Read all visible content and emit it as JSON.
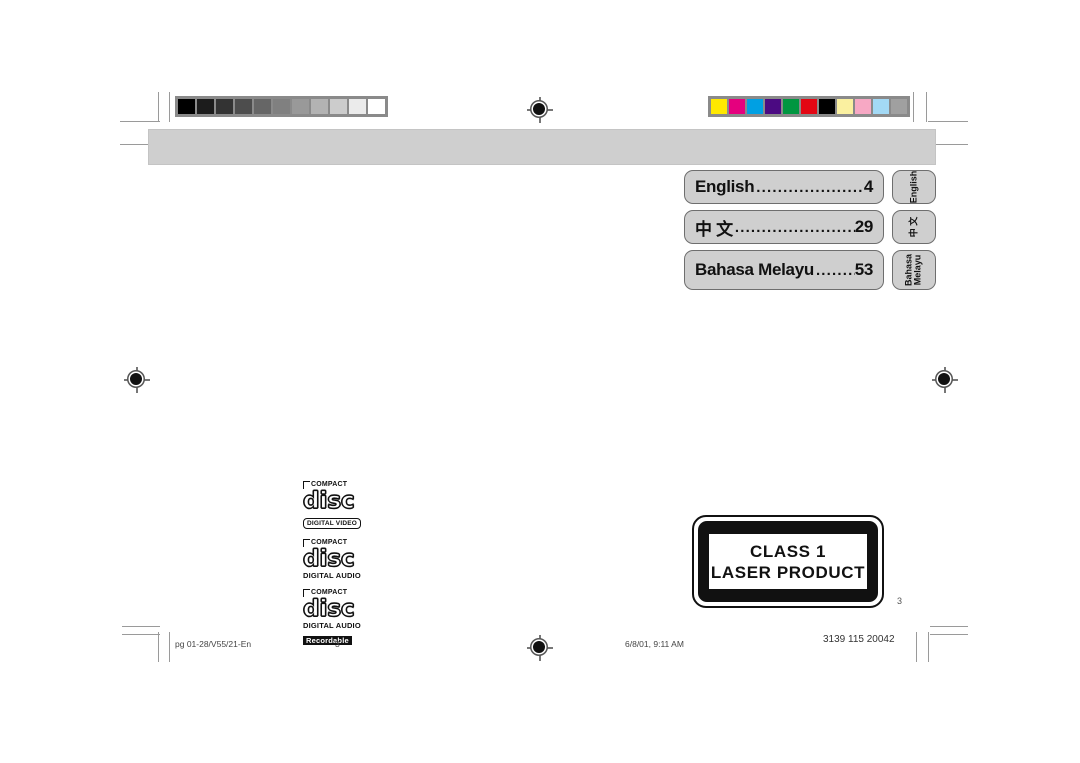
{
  "document": {
    "type": "printed-manual-page",
    "page_number": "3"
  },
  "banner": {
    "label": ""
  },
  "language_index": {
    "rows": [
      {
        "name": "English",
        "leader": "......................................",
        "page": "4",
        "tab": "English"
      },
      {
        "name": "中 文",
        "leader": "........................................",
        "page": "29",
        "tab": "中 文"
      },
      {
        "name": "Bahasa Melayu",
        "leader": "....................",
        "page": "53",
        "tab": "Bahasa\nMelayu"
      }
    ]
  },
  "logos": {
    "cd_items": [
      {
        "compact": "COMPACT",
        "word": "disc",
        "sub": "DIGITAL VIDEO",
        "sub_style": "boxed",
        "sub2": ""
      },
      {
        "compact": "COMPACT",
        "word": "disc",
        "sub": "DIGITAL AUDIO",
        "sub_style": "plain",
        "sub2": ""
      },
      {
        "compact": "COMPACT",
        "word": "disc",
        "sub": "DIGITAL AUDIO",
        "sub_style": "plain",
        "sub2": "Recordable"
      }
    ]
  },
  "laser_label": {
    "line1": "CLASS 1",
    "line2": "LASER PRODUCT",
    "page_number": "3"
  },
  "footer": {
    "file": "pg 01-28/V55/21-En",
    "page": "3",
    "date": "6/8/01, 9:11 AM",
    "code": "3139 115 20042"
  },
  "calibration": {
    "grayscale": [
      "#000000",
      "#1c1c1c",
      "#333333",
      "#4d4d4d",
      "#666666",
      "#808080",
      "#999999",
      "#b3b3b3",
      "#cccccc",
      "#ebebeb",
      "#ffffff"
    ],
    "colors": [
      "#ffe800",
      "#e5007e",
      "#00a0e3",
      "#4b0a82",
      "#009640",
      "#e30613",
      "#000000",
      "#faf0a0",
      "#f7a8c4",
      "#a3d9f5",
      "#a0a0a0"
    ]
  }
}
